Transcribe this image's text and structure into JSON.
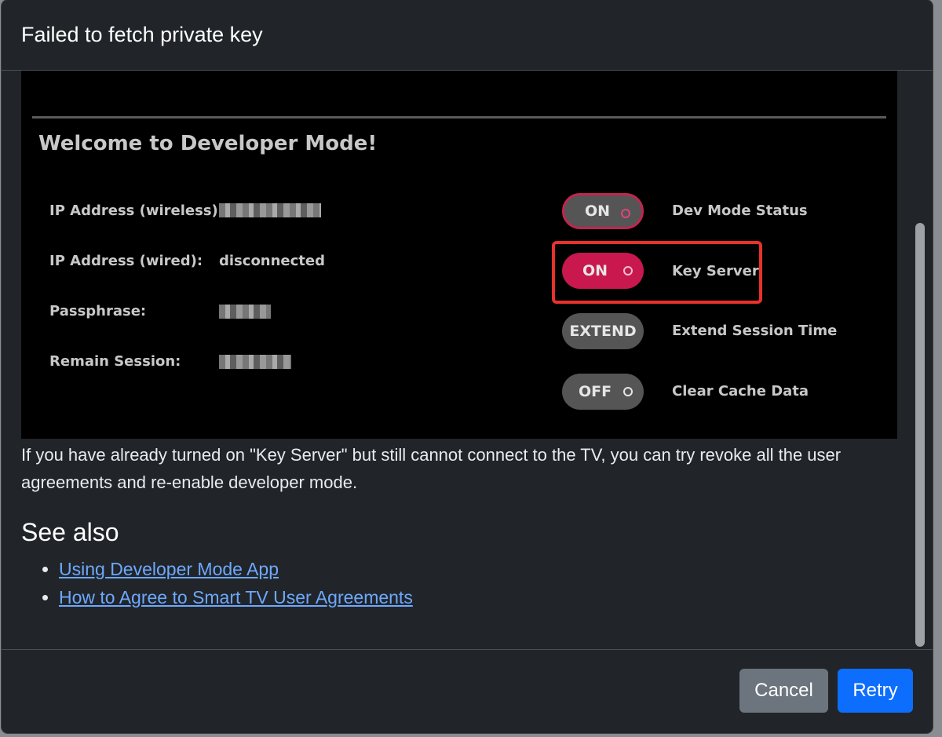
{
  "dialog": {
    "title": "Failed to fetch private key"
  },
  "tv_screen": {
    "heading": "Welcome to Developer Mode!",
    "info": [
      {
        "label": "IP Address (wireless):",
        "value": null,
        "redacted": true
      },
      {
        "label": "IP Address (wired):",
        "value": "disconnected",
        "redacted": false
      },
      {
        "label": "Passphrase:",
        "value": null,
        "redacted": true
      },
      {
        "label": "Remain Session:",
        "value": null,
        "redacted": true
      }
    ],
    "toggles": [
      {
        "text": "ON",
        "label": "Dev Mode Status"
      },
      {
        "text": "ON",
        "label": "Key Server",
        "highlighted": true
      },
      {
        "text": "EXTEND",
        "label": "Extend Session Time"
      },
      {
        "text": "OFF",
        "label": "Clear Cache Data"
      }
    ],
    "highlight_color": "#e8322a",
    "toggle_on_color": "#c8184e"
  },
  "message": "If you have already turned on \"Key Server\" but still cannot connect to the TV, you can try revoke all the user agreements and re-enable developer mode.",
  "see_also": {
    "heading": "See also",
    "links": [
      {
        "text": "Using Developer Mode App"
      },
      {
        "text": "How to Agree to Smart TV User Agreements"
      }
    ]
  },
  "footer": {
    "cancel_label": "Cancel",
    "retry_label": "Retry"
  },
  "colors": {
    "dialog_bg": "#212529",
    "link": "#6ea8fe",
    "primary": "#0d6efd",
    "secondary": "#6c757d"
  }
}
